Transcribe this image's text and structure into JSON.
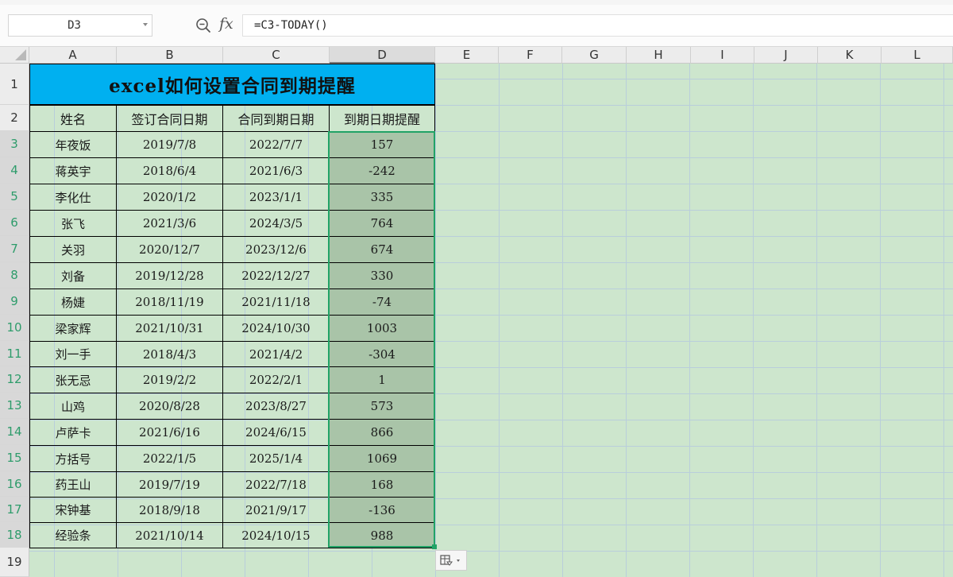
{
  "formula_bar": {
    "name_box": "D3",
    "fx_label": "fx",
    "formula": "=C3-TODAY()"
  },
  "columns": [
    "A",
    "B",
    "C",
    "D",
    "E",
    "F",
    "G",
    "H",
    "I",
    "J",
    "K",
    "L"
  ],
  "selected_column": "D",
  "rows": [
    "1",
    "2",
    "3",
    "4",
    "5",
    "6",
    "7",
    "8",
    "9",
    "10",
    "11",
    "12",
    "13",
    "14",
    "15",
    "16",
    "17",
    "18",
    "19"
  ],
  "sheet": {
    "title": "excel如何设置合同到期提醒",
    "headers": [
      "姓名",
      "签订合同日期",
      "合同到期日期",
      "到期日期提醒"
    ],
    "data": [
      [
        "年夜饭",
        "2019/7/8",
        "2022/7/7",
        "157"
      ],
      [
        "蒋英宇",
        "2018/6/4",
        "2021/6/3",
        "-242"
      ],
      [
        "李化仕",
        "2020/1/2",
        "2023/1/1",
        "335"
      ],
      [
        "张飞",
        "2021/3/6",
        "2024/3/5",
        "764"
      ],
      [
        "关羽",
        "2020/12/7",
        "2023/12/6",
        "674"
      ],
      [
        "刘备",
        "2019/12/28",
        "2022/12/27",
        "330"
      ],
      [
        "杨婕",
        "2018/11/19",
        "2021/11/18",
        "-74"
      ],
      [
        "梁家辉",
        "2021/10/31",
        "2024/10/30",
        "1003"
      ],
      [
        "刘一手",
        "2018/4/3",
        "2021/4/2",
        "-304"
      ],
      [
        "张无忌",
        "2019/2/2",
        "2022/2/1",
        "1"
      ],
      [
        "山鸡",
        "2020/8/28",
        "2023/8/27",
        "573"
      ],
      [
        "卢萨卡",
        "2021/6/16",
        "2024/6/15",
        "866"
      ],
      [
        "方括号",
        "2022/1/5",
        "2025/1/4",
        "1069"
      ],
      [
        "药王山",
        "2019/7/19",
        "2022/7/18",
        "168"
      ],
      [
        "宋钟基",
        "2018/9/18",
        "2021/9/17",
        "-136"
      ],
      [
        "经验条",
        "2021/10/14",
        "2024/10/15",
        "988"
      ]
    ]
  },
  "colors": {
    "title_fill": "#00b0f0",
    "sheet_background": "#cde6cd",
    "selection_fill": "#a9c4a8",
    "selection_border": "#21a366"
  },
  "icons": {
    "zoom": "zoom-formula-icon",
    "quick_analysis": "quick-analysis-icon"
  }
}
